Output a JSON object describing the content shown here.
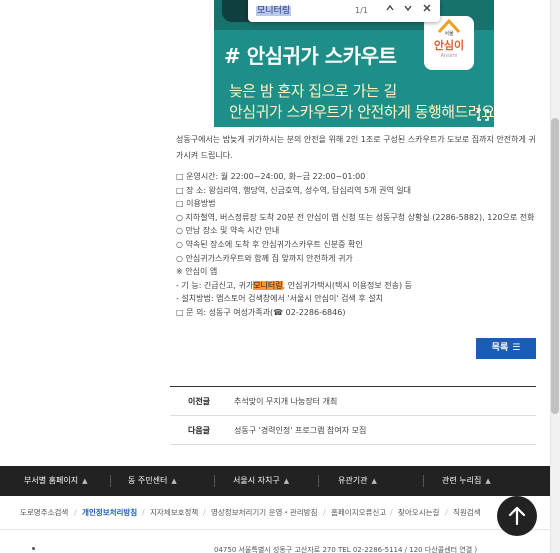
{
  "find_bar": {
    "query": "모니터링",
    "count": "1/1",
    "prev_label": "∧",
    "next_label": "∨",
    "close_label": "✕"
  },
  "banner": {
    "title": "# 안심귀가 스카우트",
    "line1": "늦은 밤 혼자 집으로 가는 길",
    "line2": "안심귀가 스카우트가 안전하게 동행해드려요",
    "logo_small": "서울",
    "logo_main": "안심이",
    "logo_sub": "Ansimi",
    "expand_icon": "expand-icon"
  },
  "description": "성동구에서는 밤늦게 귀가하시는 분의 안전을 위해 2인 1조로 구성된 스카우트가 도보로 집까지 안전하게 귀가시켜 드립니다.",
  "info_lines": [
    "□ 운영시간: 월 22:00~24:00, 화~금 22:00~01:00",
    "□ 장 소: 왕십리역, 행당역, 신금호역, 성수역, 답십리역 5개 권역 일대",
    "□ 이용방법",
    "○ 지하철역, 버스정류장 도착 20분 전 안심이 앱 신청 또는 성동구청 상황실 (2286-5882), 120으로 전화",
    "○ 만남 장소 및 약속 시간 안내",
    "○ 약속된 장소에 도착 후 안심귀가스카우트 신분증 확인",
    "○ 안심귀가스카우트와 함께 집 앞까지 안전하게 귀가",
    "※ 안심이 앱"
  ],
  "feature_line": {
    "before": "- 기 능: 긴급신고, 귀가",
    "highlight": "모니터링",
    "after": ", 안심귀가택시(택시 이용정보 전송) 등"
  },
  "info_lines_after": [
    "- 설치방법: 앱스토어 검색창에서 '서울시 안심이' 검색 후 설치",
    "□ 문 의: 성동구 여성가족과(☎ 02-2286-6846)"
  ],
  "list_button": {
    "label": "목록",
    "icon": "☰"
  },
  "navigation": [
    {
      "label": "이전글",
      "title": "추석맞이 무지개 나눔장터 개최"
    },
    {
      "label": "다음글",
      "title": "성동구 '경력인정' 프로그램 참여자 모집"
    }
  ],
  "footer_nav": [
    {
      "label": "부서별 홈페이지",
      "caret": "▲"
    },
    {
      "label": "동 주민센터",
      "caret": "▲"
    },
    {
      "label": "서울시 자치구",
      "caret": "▲"
    },
    {
      "label": "유관기관",
      "caret": "▲"
    },
    {
      "label": "관련 누리집",
      "caret": "▲"
    }
  ],
  "footer_links": [
    "도로명주소검색",
    "개인정보처리방침",
    "지자체보호정책",
    "영상정보처리기기 운영・관리방침",
    "홈페이지오류신고",
    "찾아오시는길",
    "직원검색"
  ],
  "address": "04750 서울특별시 성동구 고산자로 270    TEL 02-2286-5114 / 120 다산콜센터 연결 )",
  "top_button_icon": "arrow-up-icon"
}
